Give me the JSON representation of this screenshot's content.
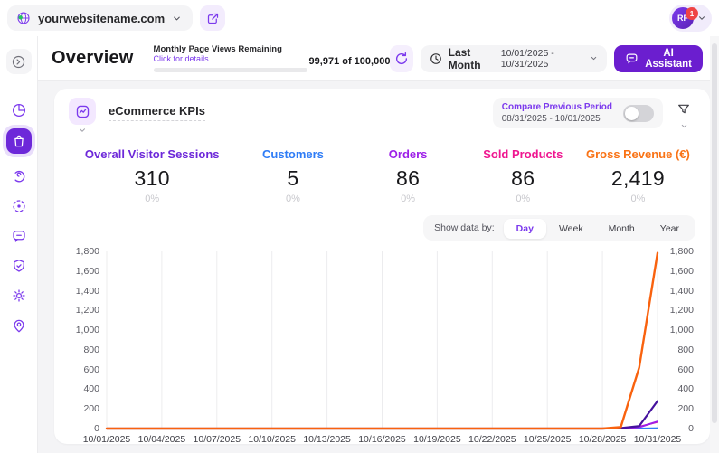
{
  "topbar": {
    "site_selector": {
      "label": "yourwebsitename.com"
    },
    "user": {
      "initials": "RF",
      "badge": "1"
    }
  },
  "header": {
    "title": "Overview",
    "page_views": {
      "title": "Monthly Page Views Remaining",
      "link": "Click for details",
      "value": "99,971 of 100,000"
    },
    "period": {
      "label": "Last Month",
      "range": "10/01/2025 - 10/31/2025"
    },
    "ai_button": "AI Assistant"
  },
  "sidebar": {
    "items": [
      {
        "name": "dashboard",
        "active": false
      },
      {
        "name": "ecommerce",
        "active": true
      },
      {
        "name": "behavior",
        "active": false
      },
      {
        "name": "audience",
        "active": false
      },
      {
        "name": "feedback",
        "active": false
      },
      {
        "name": "security",
        "active": false
      },
      {
        "name": "settings",
        "active": false
      },
      {
        "name": "visitor-location",
        "active": false
      }
    ]
  },
  "card": {
    "title": "eCommerce KPIs",
    "compare": {
      "label": "Compare Previous Period",
      "range": "08/31/2025 - 10/01/2025",
      "enabled": false
    },
    "kpis": [
      {
        "label": "Overall Visitor Sessions",
        "value": "310",
        "change": "0%",
        "color": "#6d28d9"
      },
      {
        "label": "Customers",
        "value": "5",
        "change": "0%",
        "color": "#2e7cf6"
      },
      {
        "label": "Orders",
        "value": "86",
        "change": "0%",
        "color": "#9d1fe8"
      },
      {
        "label": "Sold Products",
        "value": "86",
        "change": "0%",
        "color": "#ef1690"
      },
      {
        "label": "Gross Revenue (€)",
        "value": "2,419",
        "change": "0%",
        "color": "#f97316"
      }
    ],
    "show_data_by": {
      "label": "Show data by:",
      "tabs": [
        "Day",
        "Week",
        "Month",
        "Year"
      ],
      "active": "Day"
    }
  },
  "chart_data": {
    "type": "line",
    "x": [
      "10/01/2025",
      "10/02/2025",
      "10/03/2025",
      "10/04/2025",
      "10/05/2025",
      "10/06/2025",
      "10/07/2025",
      "10/08/2025",
      "10/09/2025",
      "10/10/2025",
      "10/11/2025",
      "10/12/2025",
      "10/13/2025",
      "10/14/2025",
      "10/15/2025",
      "10/16/2025",
      "10/17/2025",
      "10/18/2025",
      "10/19/2025",
      "10/20/2025",
      "10/21/2025",
      "10/22/2025",
      "10/23/2025",
      "10/24/2025",
      "10/25/2025",
      "10/26/2025",
      "10/27/2025",
      "10/28/2025",
      "10/29/2025",
      "10/30/2025",
      "10/31/2025"
    ],
    "x_ticks": [
      "10/01/2025",
      "10/04/2025",
      "10/07/2025",
      "10/10/2025",
      "10/13/2025",
      "10/16/2025",
      "10/19/2025",
      "10/22/2025",
      "10/25/2025",
      "10/28/2025",
      "10/31/2025"
    ],
    "y_ticks": [
      "1,800",
      "1,600",
      "1,400",
      "1,200",
      "1,000",
      "800",
      "600",
      "400",
      "200",
      "0"
    ],
    "ylim": [
      0,
      1800
    ],
    "grid": "vertical-only",
    "legend": "none",
    "series": [
      {
        "name": "Customers",
        "color": "#2e7cf6",
        "width": 1.8,
        "values": [
          0,
          0,
          0,
          0,
          0,
          0,
          0,
          0,
          0,
          0,
          0,
          0,
          0,
          0,
          0,
          0,
          0,
          0,
          0,
          0,
          0,
          0,
          0,
          0,
          0,
          0,
          0,
          0,
          0,
          1,
          4
        ]
      },
      {
        "name": "Sold Products",
        "color": "#ef1690",
        "width": 1.8,
        "values": [
          0,
          0,
          0,
          0,
          0,
          0,
          0,
          0,
          0,
          0,
          0,
          0,
          0,
          0,
          0,
          0,
          0,
          0,
          0,
          0,
          0,
          0,
          0,
          0,
          0,
          0,
          0,
          0,
          0,
          20,
          66
        ]
      },
      {
        "name": "Orders",
        "color": "#9d1fe8",
        "width": 2,
        "values": [
          0,
          0,
          0,
          0,
          0,
          0,
          0,
          0,
          0,
          0,
          0,
          0,
          0,
          0,
          0,
          0,
          0,
          0,
          0,
          0,
          0,
          0,
          0,
          0,
          0,
          0,
          0,
          0,
          0,
          14,
          72
        ]
      },
      {
        "name": "Overall Visitor Sessions",
        "color": "#45129e",
        "width": 2.2,
        "values": [
          0,
          0,
          0,
          0,
          0,
          0,
          0,
          0,
          0,
          0,
          0,
          0,
          0,
          0,
          0,
          0,
          0,
          0,
          0,
          0,
          0,
          0,
          0,
          0,
          0,
          0,
          0,
          0,
          5,
          25,
          280
        ]
      },
      {
        "name": "Gross Revenue (€)",
        "color": "#f9620e",
        "width": 2.4,
        "values": [
          0,
          0,
          0,
          0,
          0,
          0,
          0,
          0,
          0,
          0,
          0,
          0,
          0,
          0,
          0,
          0,
          0,
          0,
          0,
          0,
          0,
          0,
          0,
          0,
          0,
          0,
          0,
          0,
          15,
          620,
          1784
        ]
      }
    ]
  }
}
